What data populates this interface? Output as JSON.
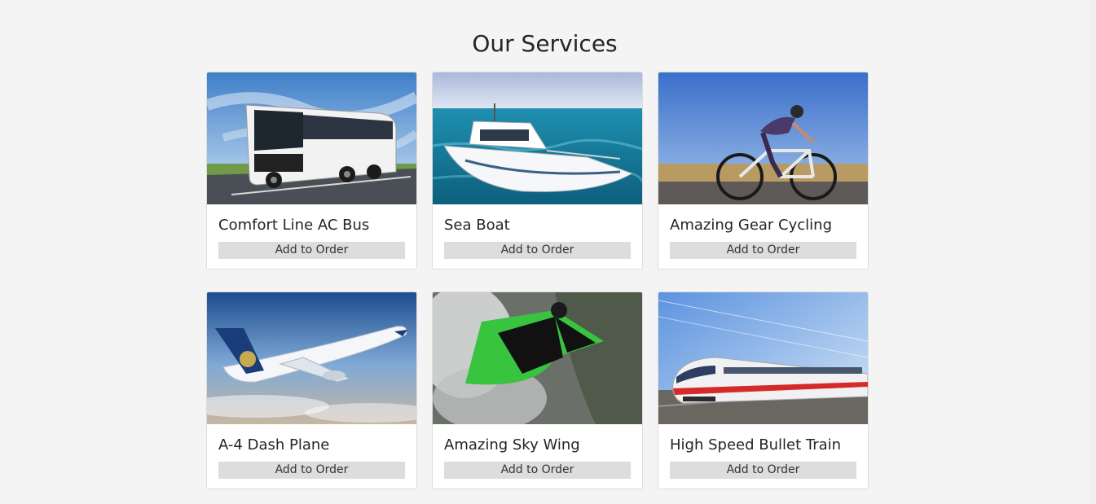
{
  "page": {
    "title": "Our Services"
  },
  "services": [
    {
      "title": "Comfort Line AC Bus",
      "button_label": "Add to Order",
      "image": "bus-image"
    },
    {
      "title": "Sea Boat",
      "button_label": "Add to Order",
      "image": "boat-image"
    },
    {
      "title": "Amazing Gear Cycling",
      "button_label": "Add to Order",
      "image": "cyclist-image"
    },
    {
      "title": "A-4 Dash Plane",
      "button_label": "Add to Order",
      "image": "plane-image"
    },
    {
      "title": "Amazing Sky Wing",
      "button_label": "Add to Order",
      "image": "wingsuit-image"
    },
    {
      "title": "High Speed Bullet Train",
      "button_label": "Add to Order",
      "image": "train-image"
    }
  ],
  "colors": {
    "background": "#f4f4f4",
    "card": "#ffffff",
    "button": "#dddddd",
    "text": "#212529"
  }
}
